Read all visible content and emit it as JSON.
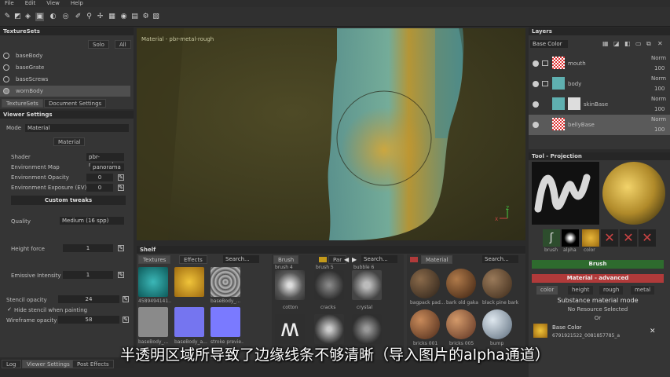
{
  "menu": [
    "File",
    "Edit",
    "View",
    "Help"
  ],
  "texture_sets": {
    "title": "TextureSets",
    "btn_solo": "Solo",
    "btn_all": "All",
    "items": [
      "baseBody",
      "baseGrate",
      "baseScrews",
      "wornBody"
    ],
    "tabs": [
      "TextureSets",
      "Document Settings"
    ]
  },
  "viewer": {
    "title": "Viewer Settings",
    "mode_label": "Mode",
    "mode_value": "Material",
    "material_btn": "Material",
    "shader_label": "Shader",
    "shader_value": "pbr-m...rough",
    "env_map_label": "Environment Map",
    "env_map_value": "panorama",
    "env_opacity_label": "Environment Opacity",
    "env_opacity_value": "0",
    "env_exposure_label": "Environment Exposure (EV)",
    "env_exposure_value": "0",
    "custom_tweaks": "Custom tweaks",
    "quality_label": "Quality",
    "quality_value": "Medium (16 spp)",
    "height_force_label": "Height force",
    "height_force_value": "1",
    "emissive_label": "Emissive Intensity",
    "emissive_value": "1",
    "stencil_label": "Stencil opacity",
    "stencil_value": "24",
    "hide_stencil_label": "Hide stencil when painting",
    "wireframe_label": "Wireframe opacity",
    "wireframe_value": "58"
  },
  "bottom_tabs": [
    "Log",
    "Viewer Settings",
    "Post Effects"
  ],
  "viewport": {
    "label": "Material - pbr-metal-rough",
    "axis_z": "Z",
    "axis_x": "X"
  },
  "shelf": {
    "title": "Shelf",
    "tabs": [
      "Textures",
      "Effects"
    ],
    "search": "Search...",
    "textures": [
      "4589494141...",
      "",
      "baseBody_...",
      "baseBody_...",
      "baseBody_a...",
      "stroke previe..."
    ],
    "brush_tab": "Brush",
    "particles_tab": "Par",
    "brush_top_labels": [
      "brush 4",
      "brush 5",
      "bubble 6"
    ],
    "brushes": [
      "cotton",
      "cracks",
      "crystal",
      "",
      "",
      ""
    ],
    "material_tab": "Material",
    "materials": [
      "bagpack pad...",
      "bark old gaka",
      "black pine bark",
      "bricks 001",
      "bricks 005",
      "bump"
    ]
  },
  "layers": {
    "title": "Layers",
    "channel": "Base Color",
    "items": [
      {
        "name": "mouth",
        "blend": "Norm",
        "opacity": "100"
      },
      {
        "name": "body",
        "blend": "Norm",
        "opacity": "100"
      },
      {
        "name": "skinBase",
        "blend": "Norm",
        "opacity": "100"
      },
      {
        "name": "bellyBase",
        "blend": "Norm",
        "opacity": "100"
      }
    ]
  },
  "tool": {
    "title": "Tool - Projection",
    "slots": [
      "brush",
      "alpha",
      "color",
      "",
      "",
      ""
    ],
    "brush_header": "Brush",
    "material_header": "Material - advanced",
    "channels": [
      "color",
      "height",
      "rough",
      "metal"
    ],
    "substance_mode": "Substance material mode",
    "no_resource": "No Resource Selected",
    "or": "Or",
    "base_color_label": "Base Color",
    "base_color_id": "6791921522_0081857785_a"
  },
  "subtitle": "半透明区域所导致了边缘线条不够清晰（导入图片的alpha通道）",
  "colors": {
    "accent_red": "#b03a3a",
    "accent_green": "#2e6b2e",
    "layer_selected": "#5a5a5a"
  }
}
